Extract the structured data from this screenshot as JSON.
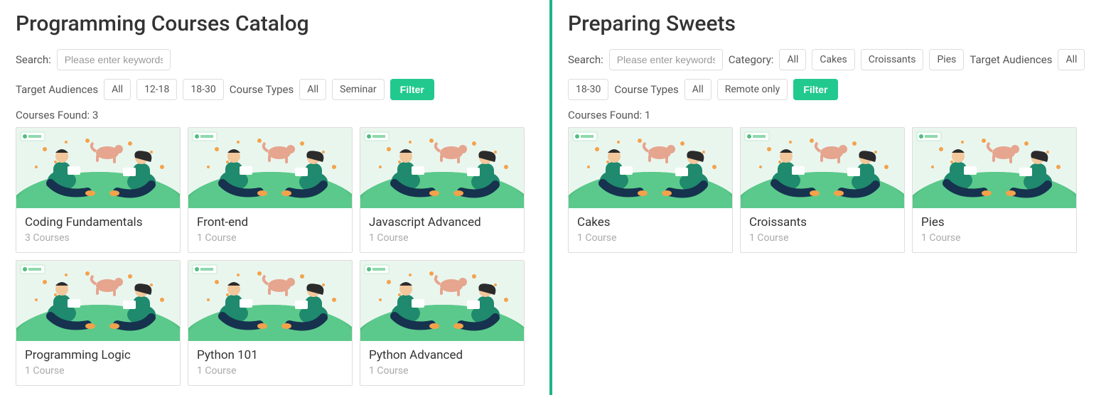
{
  "left": {
    "title": "Programming Courses Catalog",
    "search_label": "Search:",
    "search_placeholder": "Please enter keywords",
    "audiences_label": "Target Audiences",
    "audience_all": "All",
    "audience_12_18": "12-18",
    "audience_18_30": "18-30",
    "course_types_label": "Course Types",
    "course_type_all": "All",
    "course_type_seminar": "Seminar",
    "filter_button": "Filter",
    "found_label": "Courses Found: 3",
    "cards": [
      {
        "title": "Coding Fundamentals",
        "sub": "3 Courses"
      },
      {
        "title": "Front-end",
        "sub": "1 Course"
      },
      {
        "title": "Javascript Advanced",
        "sub": "1 Course"
      },
      {
        "title": "Programming Logic",
        "sub": "1 Course"
      },
      {
        "title": "Python 101",
        "sub": "1 Course"
      },
      {
        "title": "Python Advanced",
        "sub": "1 Course"
      }
    ]
  },
  "right": {
    "title": "Preparing Sweets",
    "search_label": "Search:",
    "search_placeholder": "Please enter keywords",
    "category_label": "Category:",
    "category_all": "All",
    "category_cakes": "Cakes",
    "category_croissants": "Croissants",
    "category_pies": "Pies",
    "audiences_label": "Target Audiences",
    "audience_all": "All",
    "audience_18_30": "18-30",
    "course_types_label": "Course Types",
    "course_type_all": "All",
    "course_type_remote": "Remote only",
    "filter_button": "Filter",
    "found_label": "Courses Found: 1",
    "cards": [
      {
        "title": "Cakes",
        "sub": "1 Course"
      },
      {
        "title": "Croissants",
        "sub": "1 Course"
      },
      {
        "title": "Pies",
        "sub": "1 Course"
      }
    ]
  }
}
